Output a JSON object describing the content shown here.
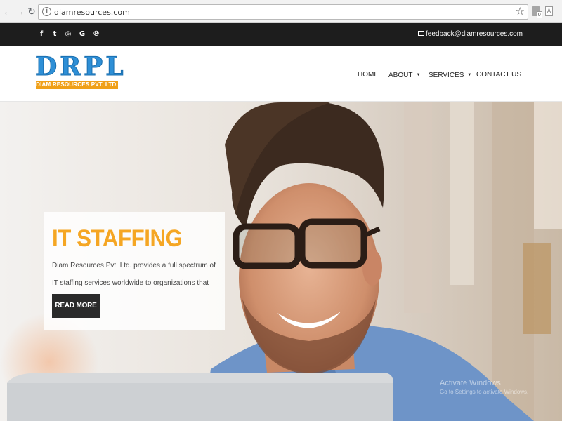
{
  "browser": {
    "url": "diamresources.com",
    "ext_badge": "0",
    "ext2_label": "A"
  },
  "topbar": {
    "social_icons": [
      "facebook-icon",
      "twitter-icon",
      "instagram-icon",
      "google-icon",
      "pinterest-icon"
    ],
    "social_glyphs": [
      "f",
      "t",
      "◎",
      "G",
      "℗"
    ],
    "email": "feedback@diamresources.com"
  },
  "header": {
    "logo_text": "DRPL",
    "logo_tagline": "DIAM RESOURCES PVT. LTD.",
    "menu": {
      "home": "HOME",
      "about": "ABOUT",
      "services": "SERVICES",
      "contact": "CONTACT US"
    }
  },
  "hero": {
    "title": "IT STAFFING",
    "description": "Diam Resources Pvt. Ltd. provides a full spectrum of IT staffing services worldwide to organizations that require.",
    "cta": "READ MORE"
  },
  "watermark": {
    "line1": "Activate Windows",
    "line2": "Go to Settings to activate Windows."
  },
  "colors": {
    "logo_blue": "#2e8fd6",
    "logo_orange": "#f0a018",
    "title_orange": "#f5a623",
    "topbar": "#1d1d1d",
    "button": "#2a2a2a"
  }
}
